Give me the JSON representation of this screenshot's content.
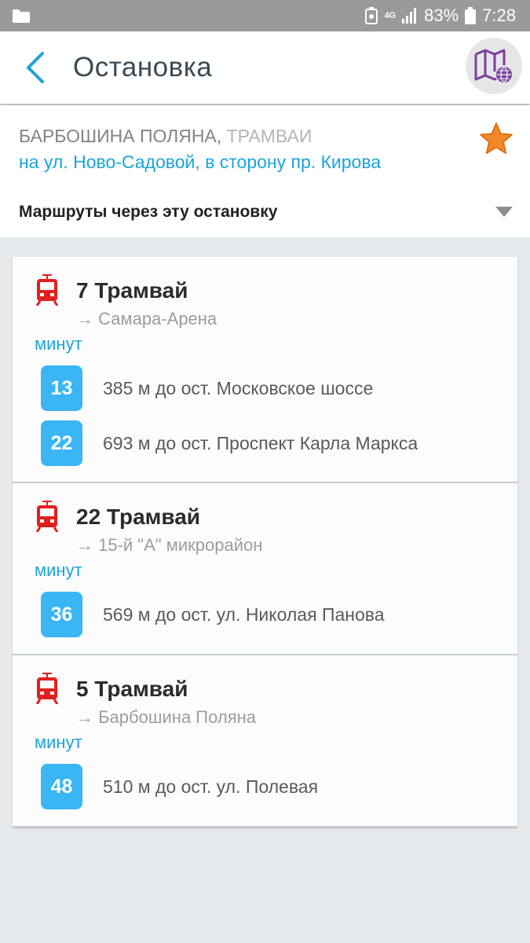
{
  "status_bar": {
    "network": "4G",
    "battery": "83%",
    "time": "7:28"
  },
  "header": {
    "title": "Остановка",
    "back_icon": "chevron-left-icon",
    "map_icon": "map-globe-icon"
  },
  "stop": {
    "name": "БАРБОШИНА ПОЛЯНА",
    "separator": ",",
    "type": "ТРАМВАИ",
    "direction": "на ул. Ново-Садовой, в сторону пр. Кирова",
    "favorite": true
  },
  "routes_header": {
    "label": "Маршруты через эту остановку"
  },
  "routes": [
    {
      "title": "7 Трамвай",
      "destination": "→ Самара-Арена",
      "minutes_label": "минут",
      "arrivals": [
        {
          "minutes": "13",
          "text": "385 м до ост. Московское шоссе"
        },
        {
          "minutes": "22",
          "text": "693 м до ост. Проспект Карла Маркса"
        }
      ]
    },
    {
      "title": "22 Трамвай",
      "destination": "→ 15-й \"А\" микрорайон",
      "minutes_label": "минут",
      "arrivals": [
        {
          "minutes": "36",
          "text": "569 м до ост. ул. Николая Панова"
        }
      ]
    },
    {
      "title": "5 Трамвай",
      "destination": "→ Барбошина Поляна",
      "minutes_label": "минут",
      "arrivals": [
        {
          "minutes": "48",
          "text": "510 м до ост. ул. Полевая"
        }
      ]
    }
  ],
  "colors": {
    "accent": "#1ba4d8",
    "badge": "#39b6f3",
    "tram_icon": "#e02020",
    "star": "#f5892a",
    "map_icon": "#7b3fa0"
  }
}
